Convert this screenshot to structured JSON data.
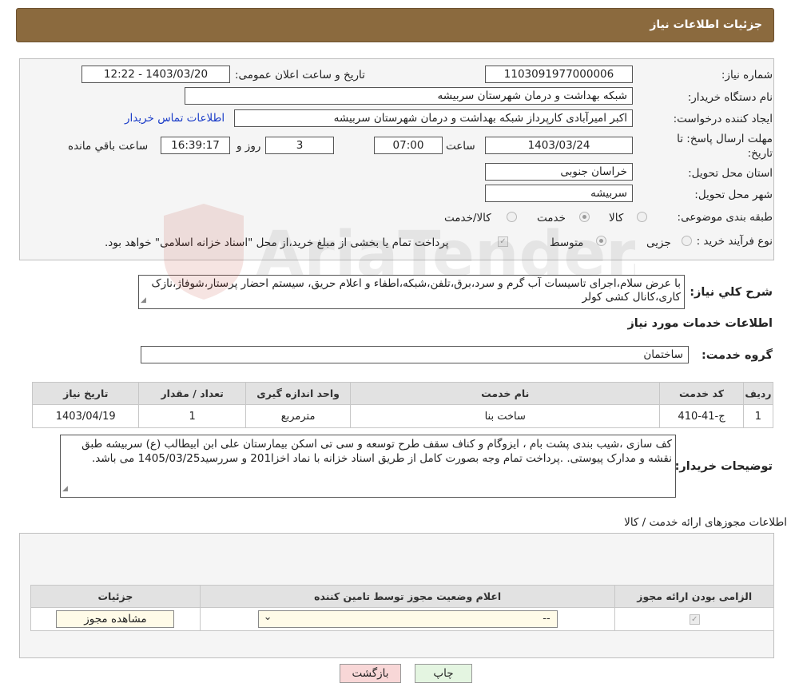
{
  "header": {
    "title": "جزئیات اطلاعات نیاز"
  },
  "form": {
    "need_number": {
      "label": "شماره نیاز:",
      "value": "1103091977000006"
    },
    "announce": {
      "label": "تاریخ و ساعت اعلان عمومی:",
      "value": "1403/03/20 - 12:22"
    },
    "buyer_org": {
      "label": "نام دستگاه خریدار:",
      "value": "شبکه بهداشت و درمان شهرستان سربیشه"
    },
    "creator": {
      "label": "ایجاد کننده درخواست:",
      "value": "اکبر امیرآبادی کارپرداز شبکه بهداشت و درمان شهرستان سربیشه",
      "contact_link": "اطلاعات تماس خریدار"
    },
    "deadline": {
      "label_line1": "مهلت ارسال پاسخ: تا",
      "label_line2": "تاریخ:",
      "date": "1403/03/24",
      "time_label": "ساعت",
      "time": "07:00",
      "days": "3",
      "days_label": "روز و",
      "remaining": "16:39:17",
      "remaining_label": "ساعت باقي مانده"
    },
    "province": {
      "label": "استان محل تحویل:",
      "value": "خراسان جنوبی"
    },
    "city": {
      "label": "شهر محل تحویل:",
      "value": "سربیشه"
    },
    "category": {
      "label": "طبقه بندی موضوعی:",
      "options": [
        "کالا",
        "خدمت",
        "کالا/خدمت"
      ],
      "selected": "خدمت"
    },
    "process": {
      "label": "نوع فرآیند خرید :",
      "options": [
        "جزیی",
        "متوسط"
      ],
      "selected": "متوسط",
      "payment_note": "پرداخت تمام یا بخشی از مبلغ خرید،از محل \"اسناد خزانه اسلامی\" خواهد بود."
    },
    "summary": {
      "label": "شرح کلي نياز:",
      "text": "با عرض سلام،اجرای تاسیسات آب گرم و سرد،برق،تلفن،شبکه،اطفاء و اعلام حریق، سیستم احضار پرستار،شوفاژ،نازک کاری،کانال کشی کولر"
    }
  },
  "services": {
    "title": "اطلاعات خدمات مورد نياز",
    "group_label": "گروه خدمت:",
    "group_value": "ساختمان",
    "columns": [
      "رديف",
      "کد خدمت",
      "نام خدمت",
      "واحد اندازه گيری",
      "تعداد / مقدار",
      "تاريخ نياز"
    ],
    "rows": [
      [
        "1",
        "ج-41-410",
        "ساخت بنا",
        "مترمربع",
        "1",
        "1403/04/19"
      ]
    ],
    "buyer_notes_label": "توضيحات خريدار:",
    "buyer_notes": "کف سازی ،شیب بندی پشت بام ، ایزوگام و  کناف سقف طرح توسعه و سی تی اسکن بیمارستان علی ابن ابیطالب (ع) سربیشه طبق نقشه و مدارک پیوستی. .پرداخت تمام  وجه بصورت کامل  از طریق اسناد خزانه با نماد اخزا201 و سررسید1405/03/25 می باشد."
  },
  "permits": {
    "title": "اطلاعات مجوزهای ارائه خدمت / کالا",
    "columns": [
      "الزامی بودن ارائه مجوز",
      "اعلام وضعیت مجوز توسط تامین کننده",
      "جزئیات"
    ],
    "row": {
      "status_value": "--",
      "view_button": "مشاهده مجوز"
    }
  },
  "buttons": {
    "print": "چاپ",
    "back": "بازگشت"
  },
  "watermark": {
    "text": "AriaTender.neT"
  },
  "colors": {
    "header_bg": "#8b6a3e",
    "link": "#1a3cc8",
    "back_button_bg": "#f8d7d7",
    "print_button_bg": "#e4f5e1"
  }
}
